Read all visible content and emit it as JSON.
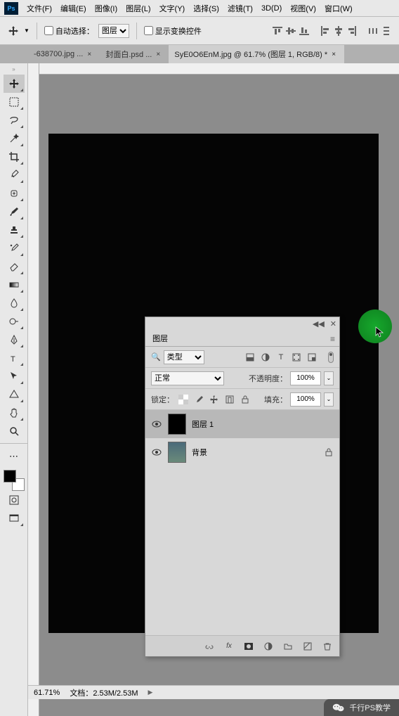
{
  "menu": [
    "文件(F)",
    "编辑(E)",
    "图像(I)",
    "图层(L)",
    "文字(Y)",
    "选择(S)",
    "滤镜(T)",
    "3D(D)",
    "视图(V)",
    "窗口(W)"
  ],
  "logo": "Ps",
  "options": {
    "autoSelectLabel": "自动选择：",
    "autoSelectValue": "图层",
    "showTransformLabel": "显示变换控件"
  },
  "tabs": [
    {
      "label": "-638700.jpg ...",
      "active": false
    },
    {
      "label": "封面白.psd ...",
      "active": false
    },
    {
      "label": "SyE0O6EnM.jpg @ 61.7% (图层 1, RGB/8) *",
      "active": true
    }
  ],
  "tools": [
    "move",
    "marquee",
    "lasso",
    "wand",
    "crop",
    "eyedrop",
    "healing",
    "brush",
    "stamp",
    "history",
    "eraser",
    "gradient",
    "blur",
    "dodge",
    "pen",
    "type",
    "path",
    "shape",
    "hand",
    "zoom"
  ],
  "extraTools": [
    "edit3d",
    "quickmask",
    "screenmode"
  ],
  "status": {
    "zoom": "61.71%",
    "docLabel": "文档：",
    "docValue": "2.53M/2.53M"
  },
  "panel": {
    "title": "图层",
    "filter": {
      "kindLabel": "类型",
      "icons": [
        "image",
        "adjust",
        "type",
        "shape",
        "smart"
      ]
    },
    "blend": {
      "mode": "正常",
      "opacityLabel": "不透明度：",
      "opacityValue": "100%"
    },
    "lock": {
      "label": "锁定：",
      "fillLabel": "填充：",
      "fillValue": "100%"
    },
    "layers": [
      {
        "name": "图层 1",
        "selected": true,
        "thumb": "black",
        "locked": false
      },
      {
        "name": "背景",
        "selected": false,
        "thumb": "img",
        "locked": true
      }
    ],
    "foot": [
      "link",
      "fx",
      "mask",
      "adj",
      "group",
      "new",
      "del"
    ]
  },
  "watermark": "千行PS教学"
}
